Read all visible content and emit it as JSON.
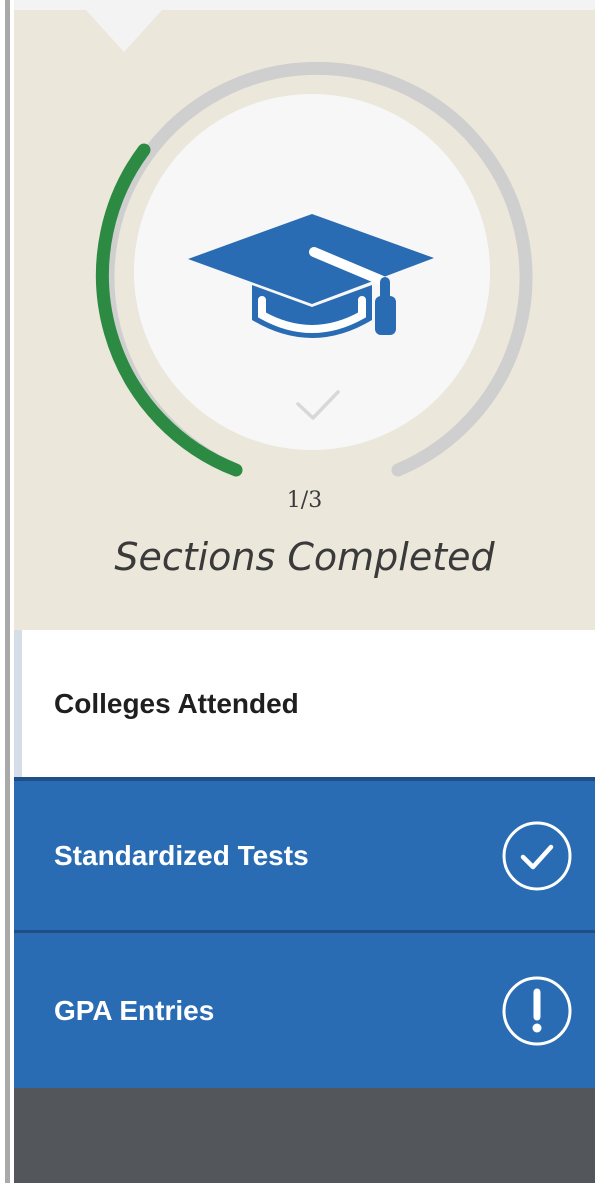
{
  "progress": {
    "completed": 1,
    "total": 3,
    "count_text": "1/3",
    "label": "Sections Completed",
    "icon": "graduation-cap-icon",
    "checkmark_icon": "checkmark-icon",
    "track_color": "#cfcfcf",
    "fill_color": "#2c8a43",
    "badge_color": "#f7f7f7",
    "icon_color": "#2a6cb4"
  },
  "sections": [
    {
      "label": "Colleges Attended",
      "status": "current",
      "status_icon": ""
    },
    {
      "label": "Standardized Tests",
      "status": "completed",
      "status_icon": "checkmark-circle-icon"
    },
    {
      "label": "GPA Entries",
      "status": "attention",
      "status_icon": "exclamation-circle-icon"
    }
  ],
  "colors": {
    "beige_background": "#ebe7da",
    "blue_background": "#2a6cb4",
    "dark_footer": "#53565b",
    "active_text": "#1f1f1f"
  }
}
